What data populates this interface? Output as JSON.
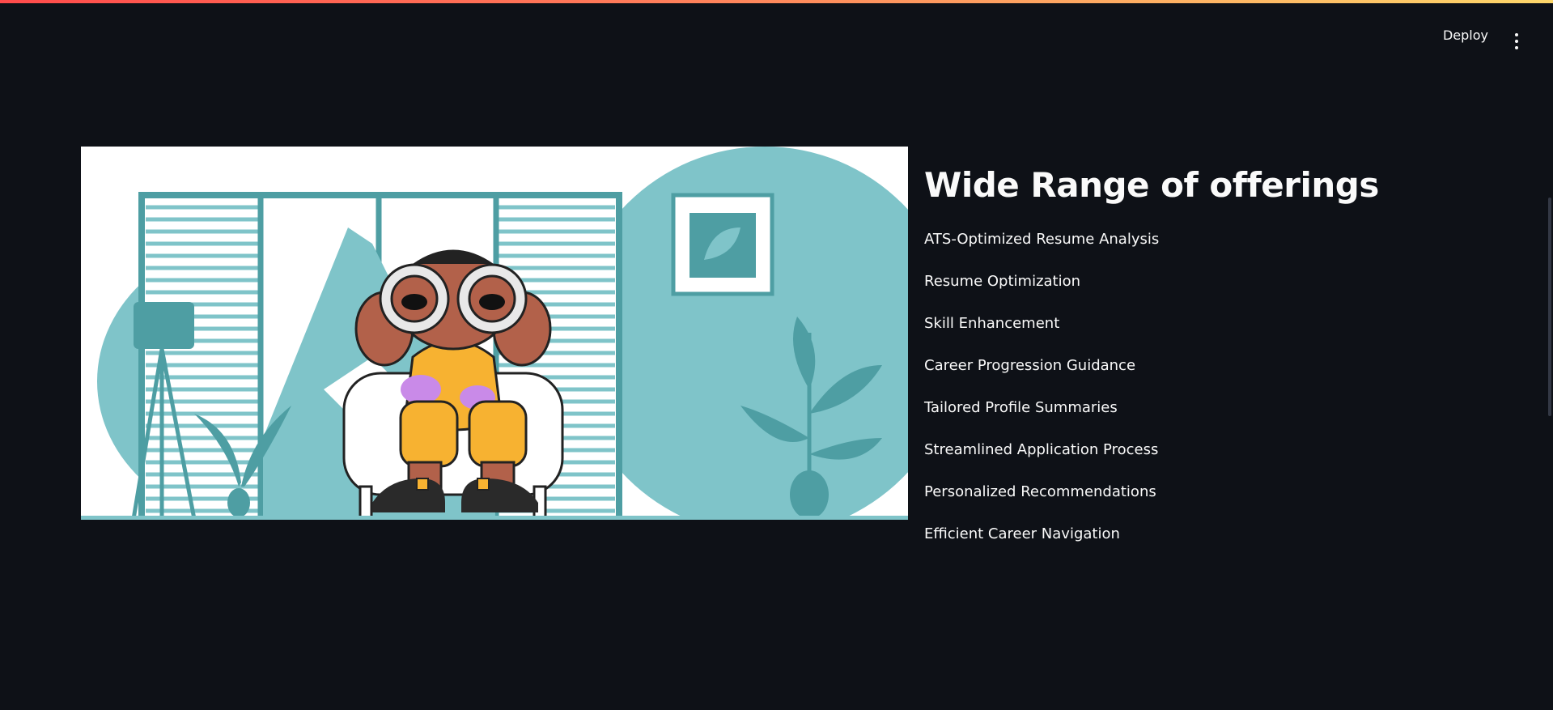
{
  "header": {
    "deploy_label": "Deploy",
    "menu_icon": "more-vertical-icon"
  },
  "hero": {
    "image_name": "person-with-binoculars-illustration",
    "colors": {
      "teal": "#7fc4c9",
      "dark_teal": "#4e9ea3",
      "skin": "#b2614a",
      "yellow": "#f7b231",
      "purple": "#c98ae8"
    }
  },
  "main": {
    "title": "Wide Range of offerings",
    "offerings": [
      "ATS-Optimized Resume Analysis",
      "Resume Optimization",
      "Skill Enhancement",
      "Career Progression Guidance",
      "Tailored Profile Summaries",
      "Streamlined Application Process",
      "Personalized Recommendations",
      "Efficient Career Navigation"
    ]
  },
  "theme": {
    "background": "#0e1117",
    "text": "#fafafa",
    "accent_start": "#ff4b4b",
    "accent_end": "#fdd76a"
  }
}
